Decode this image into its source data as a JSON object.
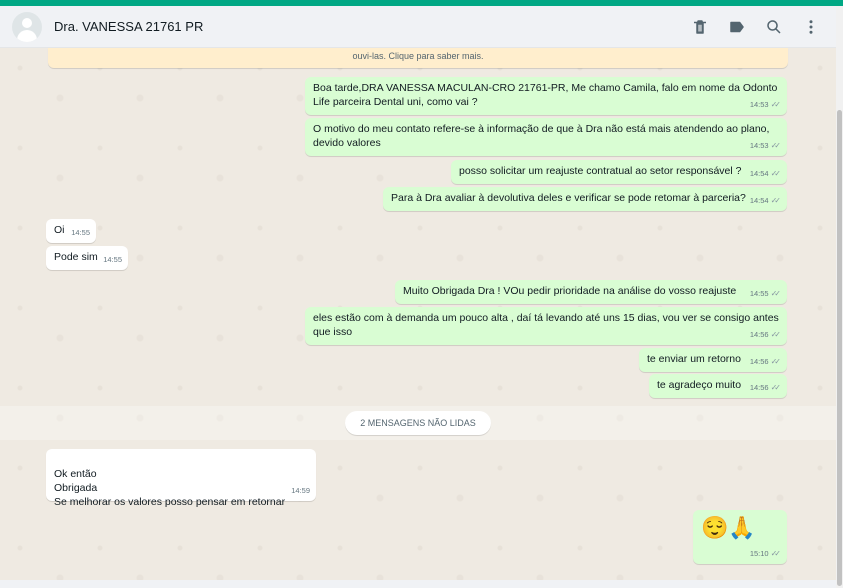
{
  "header": {
    "contact_name": "Dra. VANESSA 21761 PR",
    "icons": [
      "delete-icon",
      "label-icon",
      "search-icon",
      "menu-icon"
    ]
  },
  "notice": {
    "text": "ouvi-las. Clique para saber mais."
  },
  "messages": [
    {
      "dir": "out",
      "text": "Boa tarde,DRA VANESSA MACULAN-CRO  21761-PR, Me chamo Camila, falo em nome da Odonto Life parceira Dental uni, como vai ?",
      "time": "14:53"
    },
    {
      "dir": "out",
      "text": "O motivo do meu contato refere-se à informação de que à Dra não está mais atendendo ao plano, devido valores",
      "time": "14:53"
    },
    {
      "dir": "out",
      "text": "posso solicitar um reajuste contratual ao setor responsável ?",
      "time": "14:54"
    },
    {
      "dir": "out",
      "text": "Para à Dra avaliar à devolutiva deles e verificar se pode retomar à parceria?",
      "time": "14:54"
    },
    {
      "dir": "in",
      "text": "Oi",
      "time": "14:55"
    },
    {
      "dir": "in",
      "text": "Pode sim",
      "time": "14:55"
    },
    {
      "dir": "out",
      "text": "Muito Obrigada Dra ! VOu pedir prioridade na análise do vosso reajuste",
      "time": "14:55"
    },
    {
      "dir": "out",
      "text": "eles estão com à demanda um pouco alta , daí tá levando até uns 15 dias, vou ver se consigo antes que isso",
      "time": "14:56"
    },
    {
      "dir": "out",
      "text": "te enviar um retorno",
      "time": "14:56"
    },
    {
      "dir": "out",
      "text": "te agradeço muito",
      "time": "14:56"
    },
    {
      "dir": "in",
      "text": "Ok então\nObrigada\nSe melhorar os valores posso pensar em retornar",
      "time": "14:59"
    },
    {
      "dir": "out",
      "text": "😌🙏",
      "time": "15:10"
    }
  ],
  "unread_label": "2 MENSAGENS NÃO LIDAS",
  "colors": {
    "accent": "#00a884",
    "outgoing": "#d9fdd3",
    "incoming": "#ffffff",
    "chat_bg": "#efeae2"
  }
}
